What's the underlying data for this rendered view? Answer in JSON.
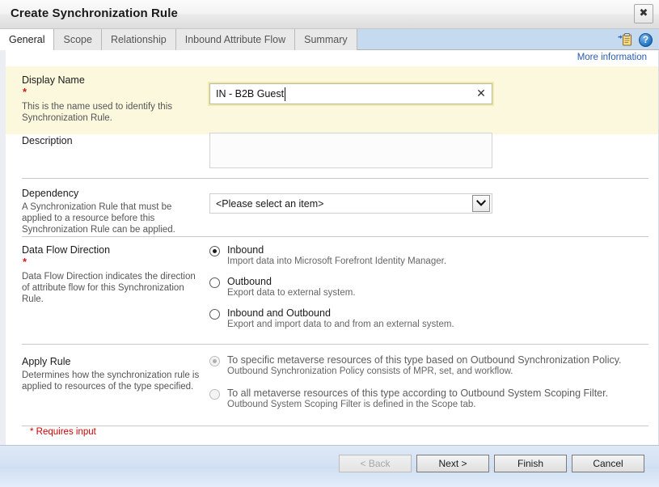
{
  "window": {
    "title": "Create Synchronization Rule",
    "close_label": "✖"
  },
  "tabs": {
    "items": [
      {
        "label": "General",
        "active": true
      },
      {
        "label": "Scope",
        "active": false
      },
      {
        "label": "Relationship",
        "active": false
      },
      {
        "label": "Inbound Attribute Flow",
        "active": false
      },
      {
        "label": "Summary",
        "active": false
      }
    ],
    "icons": {
      "clipboard": "add-clipboard-icon",
      "help": "?"
    }
  },
  "more_information": {
    "label": "More information"
  },
  "sections": {
    "display_name": {
      "title": "Display Name",
      "required_marker": "*",
      "help": "This is the name used to identify this Synchronization Rule.",
      "value": "IN - B2B Guest",
      "placeholder": "",
      "clear_label": "✕"
    },
    "description": {
      "title": "Description",
      "value": "",
      "placeholder": ""
    },
    "dependency": {
      "title": "Dependency",
      "help": "A Synchronization Rule that must be applied to a resource before this Synchronization Rule can be applied.",
      "selected": "<Please select an item>"
    },
    "data_flow_direction": {
      "title": "Data Flow Direction",
      "required_marker": "*",
      "help": "Data Flow Direction indicates the direction of attribute flow for this Synchronization Rule.",
      "options": [
        {
          "label": "Inbound",
          "sub": "Import data into Microsoft Forefront Identity Manager.",
          "checked": true,
          "disabled": false
        },
        {
          "label": "Outbound",
          "sub": "Export data to external system.",
          "checked": false,
          "disabled": false
        },
        {
          "label": "Inbound and Outbound",
          "sub": "Export and import data to and from an external system.",
          "checked": false,
          "disabled": false
        }
      ]
    },
    "apply_rule": {
      "title": "Apply Rule",
      "help": "Determines how the synchronization rule is applied to resources of the type specified.",
      "options": [
        {
          "label": "To specific metaverse resources of this type based on Outbound Synchronization Policy.",
          "sub": "Outbound Synchronization Policy consists of MPR, set, and workflow.",
          "checked": true,
          "disabled": true
        },
        {
          "label": "To all metaverse resources of this type according to Outbound System Scoping Filter.",
          "sub": "Outbound System Scoping Filter is defined in the Scope tab.",
          "checked": false,
          "disabled": true
        }
      ]
    }
  },
  "footer": {
    "requires_input": "* Requires input",
    "buttons": [
      {
        "label": "< Back",
        "disabled": true
      },
      {
        "label": "Next >",
        "disabled": false
      },
      {
        "label": "Finish",
        "disabled": false
      },
      {
        "label": "Cancel",
        "disabled": false
      }
    ]
  },
  "colors": {
    "accent_link": "#2a5db0",
    "required_red": "#cc0000",
    "highlight_band": "#fbf8dd",
    "tabstrip_blue": "#c5d9ef",
    "buttonbar_blue": "#d3e1f3"
  }
}
